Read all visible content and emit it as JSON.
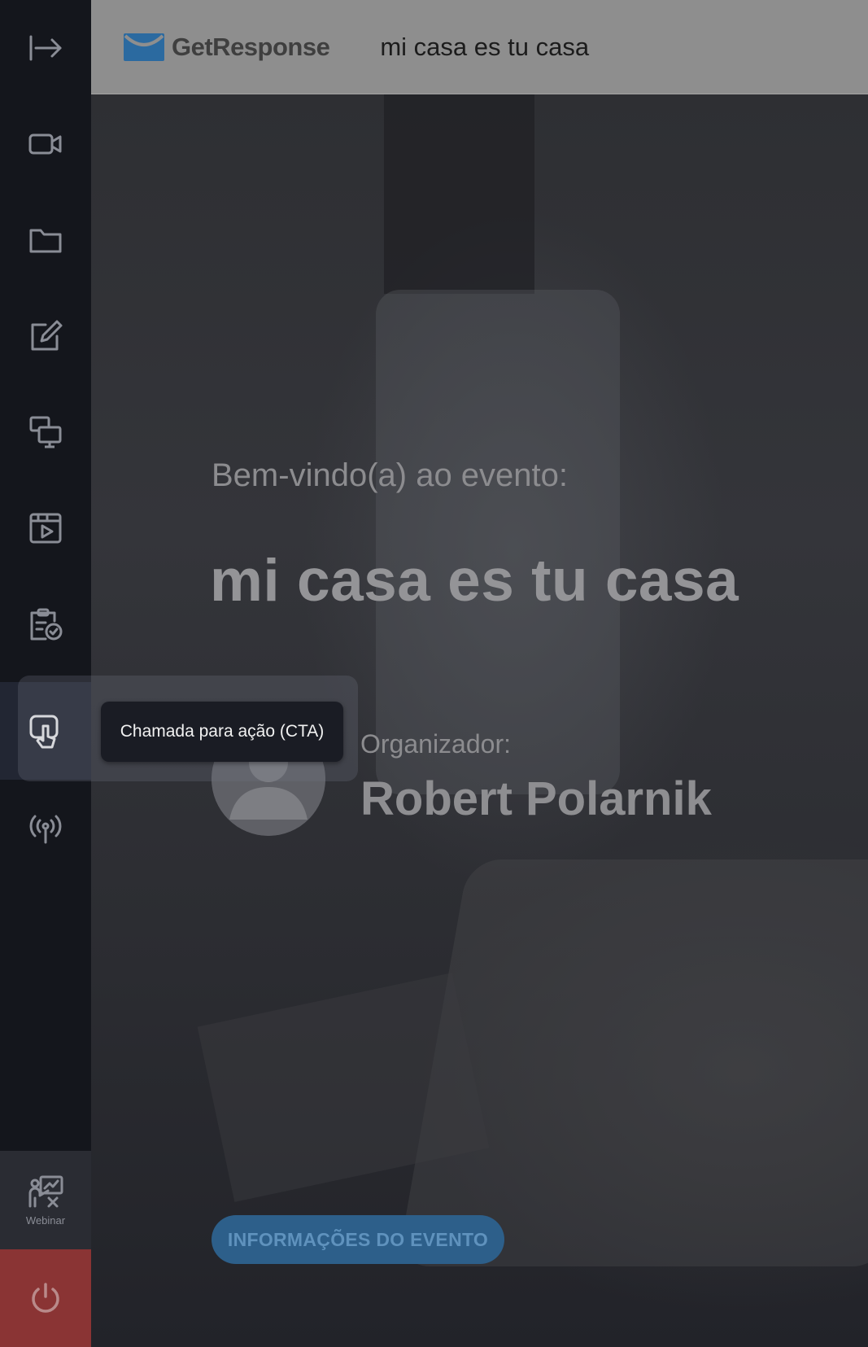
{
  "header": {
    "brand": "GetResponse",
    "event_title": "mi casa es tu casa"
  },
  "sidebar": {
    "items": [
      {
        "icon": "collapse-arrow-icon"
      },
      {
        "icon": "video-camera-icon"
      },
      {
        "icon": "folder-icon"
      },
      {
        "icon": "edit-icon"
      },
      {
        "icon": "screen-share-icon"
      },
      {
        "icon": "media-player-icon"
      },
      {
        "icon": "survey-clipboard-icon"
      },
      {
        "icon": "cta-pointer-icon",
        "active": true
      },
      {
        "icon": "broadcast-icon"
      }
    ],
    "webinar_label": "Webinar",
    "tooltip": "Chamada para ação (CTA)"
  },
  "main": {
    "welcome": "Bem-vindo(a) ao evento:",
    "title": "mi casa es tu casa",
    "organizer_label": "Organizador:",
    "organizer_name": "Robert Polarnik",
    "info_button": "INFORMAÇÕES DO EVENTO"
  },
  "colors": {
    "sidebar_bg": "#14161c",
    "power_button": "#8a3434",
    "accent_blue": "#2d5f8a",
    "logo_blue": "#2b6aa0"
  }
}
